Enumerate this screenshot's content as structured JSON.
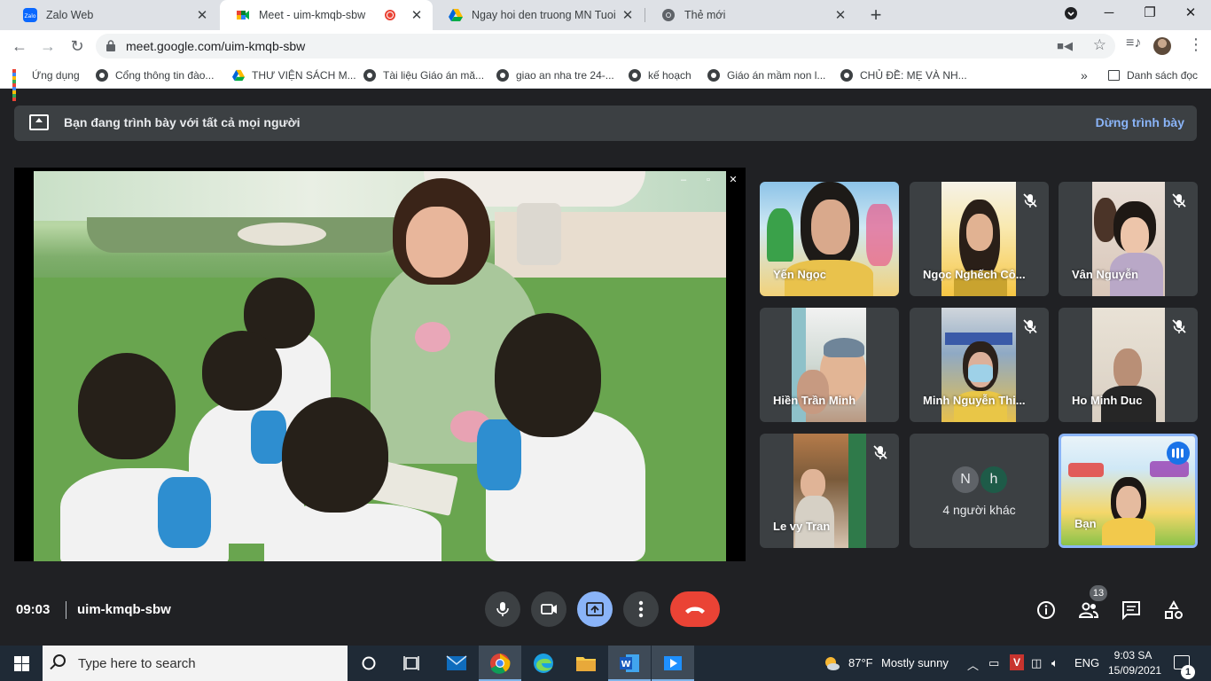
{
  "browser": {
    "tabs": [
      {
        "title": "Zalo Web",
        "icon": "zalo-icon",
        "active": false
      },
      {
        "title": "Meet - uim-kmqb-sbw",
        "icon": "meet-icon",
        "active": true,
        "recording": true
      },
      {
        "title": "Ngay hoi den truong MN Tuoi Xa",
        "icon": "drive-icon",
        "active": false
      },
      {
        "title": "Thẻ mới",
        "icon": "chrome-icon",
        "active": false
      }
    ],
    "new_tab": "+",
    "url": "meet.google.com/uim-kmqb-sbw",
    "reading_list": "Danh sách đọc",
    "bookmarks": [
      {
        "label": "Ứng dụng",
        "icon": "apps-icon"
      },
      {
        "label": "Cổng thông tin đào...",
        "icon": "globe-icon"
      },
      {
        "label": "THƯ VIỆN SÁCH M...",
        "icon": "drive-icon"
      },
      {
        "label": "Tài liệu Giáo án mă...",
        "icon": "globe-icon"
      },
      {
        "label": "giao an nha tre 24-...",
        "icon": "globe-icon"
      },
      {
        "label": "kế hoạch",
        "icon": "globe-icon"
      },
      {
        "label": "Giáo án mầm non l...",
        "icon": "globe-icon"
      },
      {
        "label": "CHỦ ĐỀ: MẸ VÀ NH...",
        "icon": "globe-icon"
      }
    ],
    "overflow": "»"
  },
  "meet": {
    "banner_text": "Bạn đang trình bày với tất cả mọi người",
    "stop_presenting": "Dừng trình bày",
    "participants": [
      {
        "name": "Yến Ngọc",
        "muted": false
      },
      {
        "name": "Ngọc Nghếch Cô...",
        "muted": true
      },
      {
        "name": "Vân Nguyễn",
        "muted": true
      },
      {
        "name": "Hiền Trần Minh",
        "muted": false
      },
      {
        "name": "Minh Nguyễn Thi...",
        "muted": true
      },
      {
        "name": "Ho Minh Duc",
        "muted": true
      },
      {
        "name": "Le vy Tran",
        "muted": true
      }
    ],
    "others": {
      "initials": [
        "N",
        "h"
      ],
      "label": "4 người khác"
    },
    "self_name": "Bạn",
    "time": "09:03",
    "meeting_code": "uim-kmqb-sbw",
    "people_count": "13",
    "colors": {
      "accent": "#8ab4f8",
      "hangup": "#ea4335",
      "bg": "#202124",
      "tile": "#3c4043"
    }
  },
  "taskbar": {
    "search_placeholder": "Type here to search",
    "weather_temp": "87°F",
    "weather_desc": "Mostly sunny",
    "language": "ENG",
    "clock_time": "9:03 SA",
    "clock_date": "15/09/2021",
    "notifications": "1"
  }
}
